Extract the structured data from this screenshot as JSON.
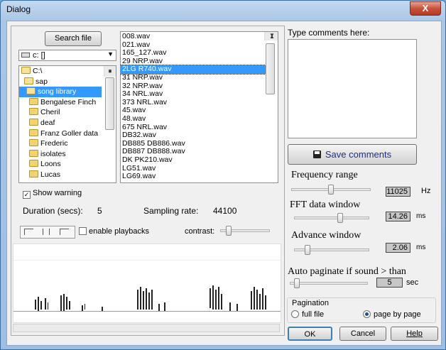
{
  "window": {
    "title": "Dialog",
    "close_glyph": "X"
  },
  "browser": {
    "search_button": "Search file",
    "drive": "c: []",
    "tree": [
      "C:\\",
      "sap",
      "song library",
      "Bengalese Finch",
      "Cheril",
      "deaf",
      "Franz Goller data",
      "Frederic",
      "isolates",
      "Loons",
      "Lucas"
    ],
    "tree_selected": "song library",
    "files": [
      "008.wav",
      "021.wav",
      "165_127.wav",
      "29 NRP.wav",
      "2LG R740.wav",
      "31 NRP.wav",
      "32 NRP.wav",
      "34 NRL.wav",
      "373 NRL.wav",
      "45.wav",
      "48.wav",
      "675 NRL.wav",
      "DB32.wav",
      "DB885 DB886.wav",
      "DB887 DB888.wav",
      "DK PK210.wav",
      "LG51.wav",
      "LG69.wav"
    ],
    "file_selected": "2LG R740.wav"
  },
  "info": {
    "show_warning": "Show warning",
    "show_warning_checked": true,
    "duration_label": "Duration (secs):",
    "duration_value": "5",
    "rate_label": "Sampling rate:",
    "rate_value": "44100",
    "enable_playbacks": "enable playbacks",
    "contrast_label": "contrast:"
  },
  "comments": {
    "label": "Type comments here:",
    "value": "",
    "save_button": "Save comments"
  },
  "settings": {
    "freq_label": "Frequency range",
    "freq_value": "11025",
    "freq_unit": "Hz",
    "fft_label": "FFT data window",
    "fft_value": "14.26",
    "fft_unit": "ms",
    "advance_label": "Advance window",
    "advance_value": "2.06",
    "advance_unit": "ms",
    "autopage_label": "Auto paginate if sound > than",
    "autopage_value": "5",
    "autopage_unit": "sec"
  },
  "pagination": {
    "group_label": "Pagination",
    "option_full": "full file",
    "option_page": "page by page",
    "selected": "page by page"
  },
  "footer": {
    "ok": "OK",
    "cancel": "Cancel",
    "help": "Help"
  },
  "colors": {
    "selection": "#3399ff",
    "save_text": "#1d2f8a",
    "value_box": "#c7c7c7"
  }
}
